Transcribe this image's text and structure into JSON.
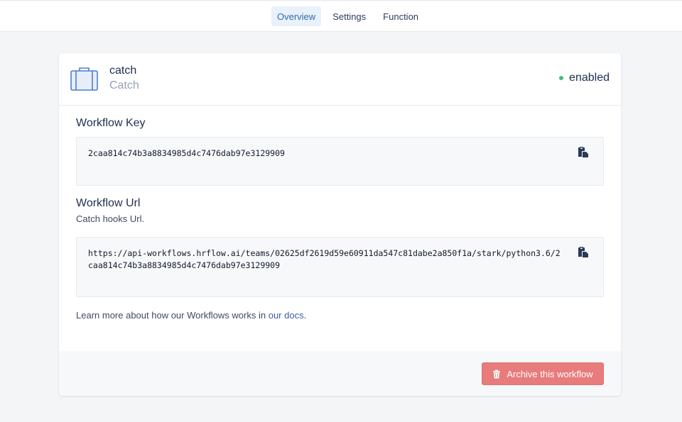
{
  "nav": {
    "tabs": [
      {
        "label": "Overview",
        "active": true
      },
      {
        "label": "Settings",
        "active": false
      },
      {
        "label": "Function",
        "active": false
      }
    ]
  },
  "workflow": {
    "name": "catch",
    "type": "Catch",
    "status": "enabled",
    "status_color": "#3fbf7f",
    "icon": "briefcase-icon"
  },
  "key_section": {
    "title": "Workflow Key",
    "value": "2caa814c74b3a8834985d4c7476dab97e3129909",
    "copy_icon": "copy-icon"
  },
  "url_section": {
    "title": "Workflow Url",
    "subtitle": "Catch hooks Url.",
    "value": "https://api-workflows.hrflow.ai/teams/02625df2619d59e60911da547c81dabe2a850f1a/stark/python3.6/2caa814c74b3a8834985d4c7476dab97e3129909",
    "copy_icon": "copy-icon"
  },
  "docs": {
    "prefix": "Learn more about how our Workflows works in ",
    "link": "our docs",
    "suffix": "."
  },
  "footer": {
    "archive_label": "Archive this workflow",
    "archive_color": "#e87b7b",
    "archive_icon": "trash-icon"
  },
  "colors": {
    "accent": "#2d6cb0",
    "link": "#3d5ba9",
    "text": "#1e2f4d"
  }
}
